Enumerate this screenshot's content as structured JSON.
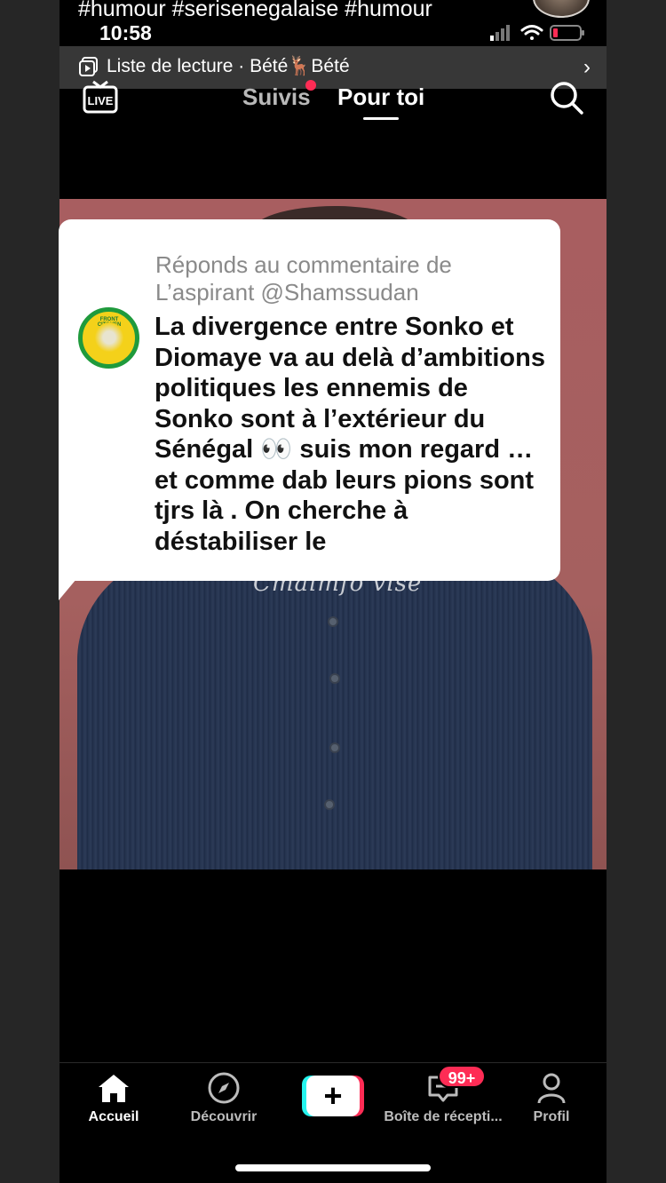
{
  "overlay": {
    "hashtags": "#humour #serisenegalaise #humour"
  },
  "status_bar": {
    "time": "10:58"
  },
  "playlist": {
    "label": "Liste de lecture · Bété🦌Bété",
    "chevron": "›"
  },
  "top_nav": {
    "live_label": "LIVE",
    "tab_following": "Suivis",
    "tab_for_you": "Pour toi"
  },
  "video": {
    "watermark": "Cmaimfo vise"
  },
  "reply": {
    "header": "Réponds au commentaire de L’aspirant @Shamssudan",
    "avatar_text": "FRONT CITOYEN",
    "body": "La divergence entre Sonko et Diomaye va au delà d’ambitions politiques les ennemis de Sonko sont à l’extérieur du Sénégal 👀 suis mon regard …et comme dab leurs pions sont tjrs là . On cherche à déstabiliser le"
  },
  "bottom_nav": {
    "home": "Accueil",
    "discover": "Découvrir",
    "create": "+",
    "inbox": "Boîte de récepti...",
    "inbox_badge": "99+",
    "profile": "Profil"
  },
  "colors": {
    "accent": "#fe2c55",
    "cyan": "#25f4ee",
    "video_bg": "#a85e60",
    "avatar_ring": "#1f9a3c",
    "avatar_fill": "#f4d11a"
  },
  "icons": [
    "playlist-icon",
    "live-icon",
    "search-icon",
    "home-icon",
    "compass-icon",
    "inbox-icon",
    "profile-icon",
    "wifi-icon",
    "signal-icon",
    "battery-icon"
  ]
}
